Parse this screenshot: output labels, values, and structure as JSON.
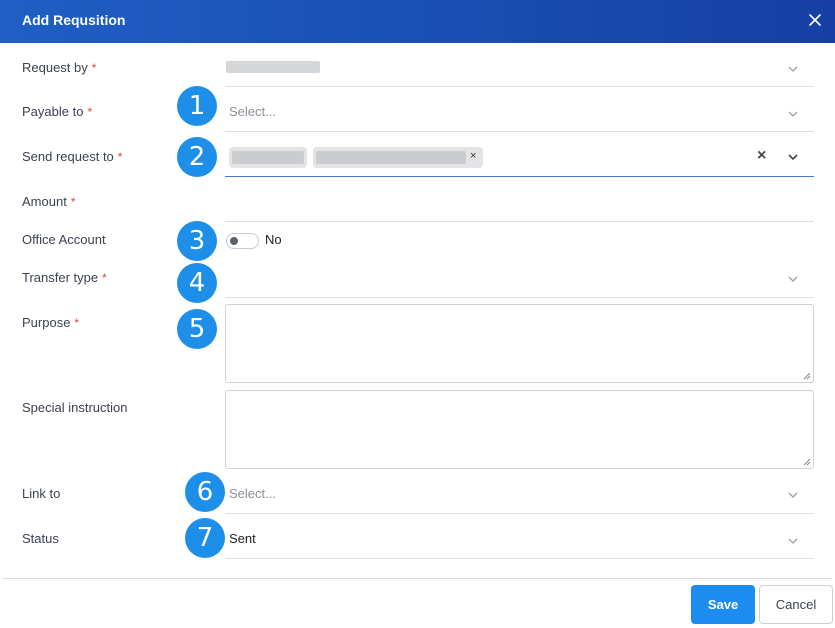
{
  "modal": {
    "title": "Add Requsition"
  },
  "fields": {
    "request_by": {
      "label": "Request by",
      "required": "*"
    },
    "payable_to": {
      "label": "Payable to",
      "required": "*",
      "placeholder": "Select..."
    },
    "send_request_to": {
      "label": "Send request to",
      "required": "*",
      "clear": "×",
      "chip_remove": "×"
    },
    "amount": {
      "label": "Amount",
      "required": "*"
    },
    "office_account": {
      "label": "Office Account",
      "toggle_value": "No"
    },
    "transfer_type": {
      "label": "Transfer type",
      "required": "*"
    },
    "purpose": {
      "label": "Purpose",
      "required": "*"
    },
    "special_instruction": {
      "label": "Special instruction"
    },
    "link_to": {
      "label": "Link to",
      "placeholder": "Select..."
    },
    "status": {
      "label": "Status",
      "value": "Sent"
    }
  },
  "badges": [
    "1",
    "2",
    "3",
    "4",
    "5",
    "6",
    "7"
  ],
  "footer": {
    "save_label": "Save",
    "cancel_label": "Cancel"
  },
  "colors": {
    "header": "#1f5fc4",
    "accent": "#1d8cf0",
    "badge": "#1e8fe8",
    "required": "#e0443d"
  }
}
